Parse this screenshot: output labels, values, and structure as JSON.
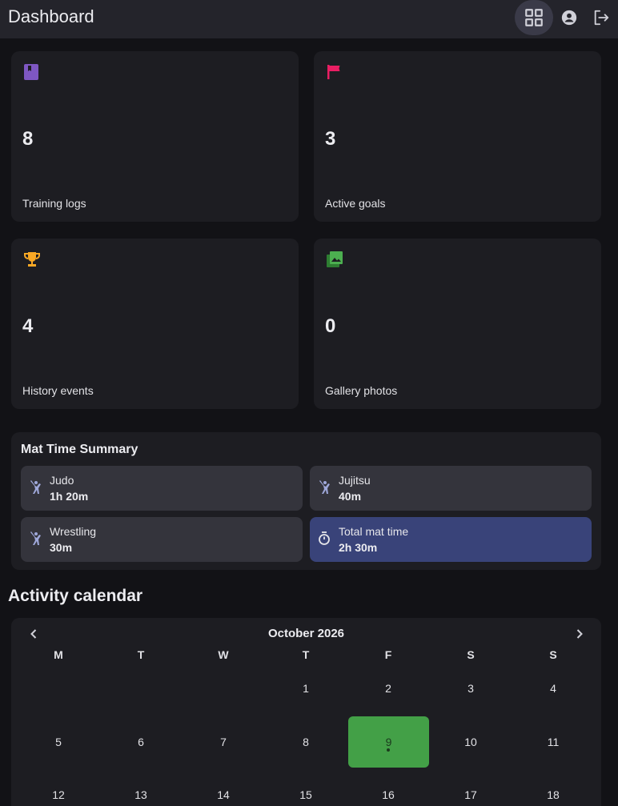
{
  "header": {
    "title": "Dashboard"
  },
  "stats": [
    {
      "value": "8",
      "label": "Training logs",
      "icon": "book-icon",
      "color": "#7e57c2"
    },
    {
      "value": "3",
      "label": "Active goals",
      "icon": "flag-icon",
      "color": "#e91e63"
    },
    {
      "value": "4",
      "label": "History events",
      "icon": "trophy-icon",
      "color": "#f9a825"
    },
    {
      "value": "0",
      "label": "Gallery photos",
      "icon": "photo-icon",
      "color": "#4caf50"
    }
  ],
  "mat_summary": {
    "title": "Mat Time Summary",
    "items": [
      {
        "name": "Judo",
        "value": "1h 20m"
      },
      {
        "name": "Jujitsu",
        "value": "40m"
      },
      {
        "name": "Wrestling",
        "value": "30m"
      },
      {
        "name": "Total mat time",
        "value": "2h 30m"
      }
    ]
  },
  "calendar": {
    "heading": "Activity calendar",
    "month": "October 2026",
    "weekdays": [
      "M",
      "T",
      "W",
      "T",
      "F",
      "S",
      "S"
    ],
    "weeks": [
      [
        "",
        "",
        "",
        "1",
        "2",
        "3",
        "4"
      ],
      [
        "5",
        "6",
        "7",
        "8",
        "9",
        "10",
        "11"
      ],
      [
        "12",
        "13",
        "14",
        "15",
        "16",
        "17",
        "18"
      ]
    ],
    "today": "9",
    "today_color": "#43a047"
  },
  "colors": {
    "accent_total": "#394379",
    "card_bg": "#1d1d22"
  }
}
